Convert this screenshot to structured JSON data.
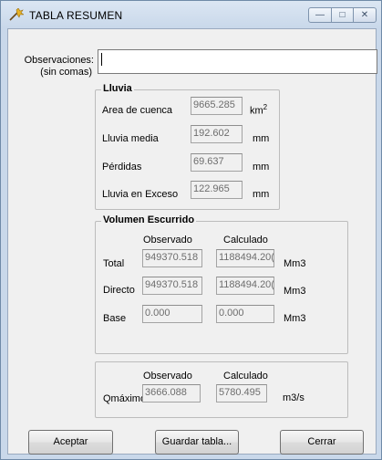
{
  "window": {
    "title": "TABLA RESUMEN",
    "controls": [
      "minimize",
      "maximize",
      "close"
    ]
  },
  "observaciones": {
    "label_line1": "Observaciones:",
    "label_line2": "(sin comas)",
    "value": ""
  },
  "lluvia": {
    "title": "Lluvia",
    "rows": [
      {
        "label": "Area de cuenca",
        "value": "9665.285",
        "unit": "km",
        "unit_sup": "2"
      },
      {
        "label": "Lluvia media",
        "value": "192.602",
        "unit": "mm",
        "unit_sup": ""
      },
      {
        "label": "Pérdidas",
        "value": "69.637",
        "unit": "mm",
        "unit_sup": ""
      },
      {
        "label": "Lluvia en Exceso",
        "value": "122.965",
        "unit": "mm",
        "unit_sup": ""
      }
    ]
  },
  "volumen": {
    "title": "Volumen Escurrido",
    "col_observado": "Observado",
    "col_calculado": "Calculado",
    "rows": [
      {
        "label": "Total",
        "observado": "949370.518",
        "calculado": "1188494.20(",
        "unit": "Mm3"
      },
      {
        "label": "Directo",
        "observado": "949370.518",
        "calculado": "1188494.20(",
        "unit": "Mm3"
      },
      {
        "label": "Base",
        "observado": "0.000",
        "calculado": "0.000",
        "unit": "Mm3"
      }
    ]
  },
  "qmax": {
    "col_observado": "Observado",
    "col_calculado": "Calculado",
    "label": "Qmáximo",
    "observado": "3666.088",
    "calculado": "5780.495",
    "unit": "m3/s"
  },
  "buttons": {
    "aceptar": "Aceptar",
    "guardar": "Guardar tabla...",
    "cerrar": "Cerrar"
  },
  "colors": {
    "titlebar": "#c9d8ea",
    "dialog": "#f0f0f0",
    "field_border": "#a3a3a3"
  }
}
